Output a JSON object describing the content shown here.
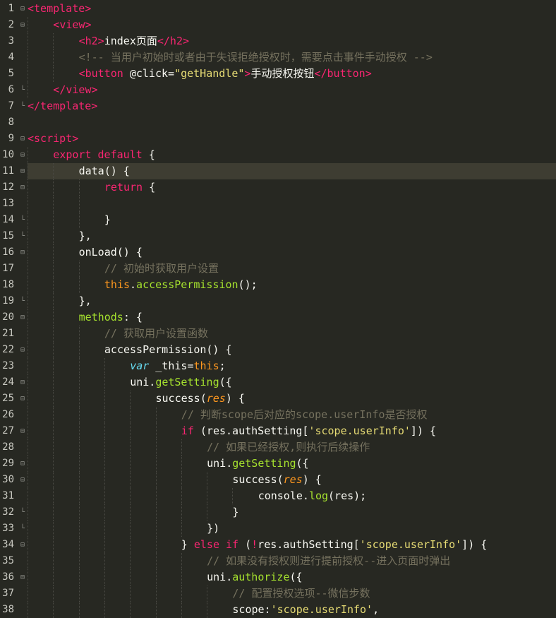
{
  "editor": {
    "theme_colors": {
      "background": "#272822",
      "active_line": "#3e3d32",
      "tag": "#f92672",
      "comment": "#75715e",
      "string": "#e6db74",
      "function": "#a6e22e",
      "this": "#fd971f",
      "text": "#f8f8f2"
    },
    "active_line": 11,
    "lines": [
      {
        "n": "1",
        "fold": "minus",
        "indent": 0,
        "tokens": [
          [
            "t-tag",
            "<template>"
          ]
        ]
      },
      {
        "n": "2",
        "fold": "minus",
        "indent": 1,
        "tokens": [
          [
            "t-tag",
            "<view>"
          ]
        ]
      },
      {
        "n": "3",
        "fold": "",
        "indent": 2,
        "tokens": [
          [
            "t-tag",
            "<h2>"
          ],
          [
            "t-txt",
            "index页面"
          ],
          [
            "t-tag",
            "</h2>"
          ]
        ]
      },
      {
        "n": "4",
        "fold": "",
        "indent": 2,
        "tokens": [
          [
            "t-cmt",
            "<!-- 当用户初始时或者由于失误拒绝授权时，需要点击事件手动授权 -->"
          ]
        ]
      },
      {
        "n": "5",
        "fold": "",
        "indent": 2,
        "tokens": [
          [
            "t-tag",
            "<button"
          ],
          [
            "t-attr",
            " @click="
          ],
          [
            "t-str",
            "\"getHandle\""
          ],
          [
            "t-tag",
            ">"
          ],
          [
            "t-txt",
            "手动授权按钮"
          ],
          [
            "t-tag",
            "</button>"
          ]
        ]
      },
      {
        "n": "6",
        "fold": "end",
        "indent": 1,
        "tokens": [
          [
            "t-tag",
            "</view>"
          ]
        ]
      },
      {
        "n": "7",
        "fold": "end",
        "indent": 0,
        "tokens": [
          [
            "t-tag",
            "</template>"
          ]
        ]
      },
      {
        "n": "8",
        "fold": "",
        "indent": 0,
        "tokens": []
      },
      {
        "n": "9",
        "fold": "minus",
        "indent": 0,
        "tokens": [
          [
            "t-tag",
            "<script>"
          ]
        ]
      },
      {
        "n": "10",
        "fold": "minus",
        "indent": 1,
        "tokens": [
          [
            "t-kw",
            "export default"
          ],
          [
            "t-txt",
            " {"
          ]
        ]
      },
      {
        "n": "11",
        "fold": "minus",
        "indent": 2,
        "tokens": [
          [
            "t-txt",
            "data() {"
          ]
        ]
      },
      {
        "n": "12",
        "fold": "minus",
        "indent": 3,
        "tokens": [
          [
            "t-kw",
            "return"
          ],
          [
            "t-txt",
            " {"
          ]
        ]
      },
      {
        "n": "13",
        "fold": "",
        "indent": 3,
        "tokens": []
      },
      {
        "n": "14",
        "fold": "end",
        "indent": 3,
        "tokens": [
          [
            "t-txt",
            "}"
          ]
        ]
      },
      {
        "n": "15",
        "fold": "end",
        "indent": 2,
        "tokens": [
          [
            "t-txt",
            "},"
          ]
        ]
      },
      {
        "n": "16",
        "fold": "minus",
        "indent": 2,
        "tokens": [
          [
            "t-txt",
            "onLoad() {"
          ]
        ]
      },
      {
        "n": "17",
        "fold": "",
        "indent": 3,
        "tokens": [
          [
            "t-cmt",
            "// 初始时获取用户设置"
          ]
        ]
      },
      {
        "n": "18",
        "fold": "",
        "indent": 3,
        "tokens": [
          [
            "t-this",
            "this"
          ],
          [
            "t-dot",
            "."
          ],
          [
            "t-prop",
            "accessPermission"
          ],
          [
            "t-txt",
            "();"
          ]
        ]
      },
      {
        "n": "19",
        "fold": "end",
        "indent": 2,
        "tokens": [
          [
            "t-txt",
            "},"
          ]
        ]
      },
      {
        "n": "20",
        "fold": "minus",
        "indent": 2,
        "tokens": [
          [
            "t-fn",
            "methods"
          ],
          [
            "t-txt",
            ": {"
          ]
        ]
      },
      {
        "n": "21",
        "fold": "",
        "indent": 3,
        "tokens": [
          [
            "t-cmt",
            "// 获取用户设置函数"
          ]
        ]
      },
      {
        "n": "22",
        "fold": "minus",
        "indent": 3,
        "tokens": [
          [
            "t-txt",
            "accessPermission() {"
          ]
        ]
      },
      {
        "n": "23",
        "fold": "",
        "indent": 4,
        "tokens": [
          [
            "t-var",
            "var"
          ],
          [
            "t-txt",
            " _this="
          ],
          [
            "t-this",
            "this"
          ],
          [
            "t-txt",
            ";"
          ]
        ]
      },
      {
        "n": "24",
        "fold": "minus",
        "indent": 4,
        "tokens": [
          [
            "t-txt",
            "uni"
          ],
          [
            "t-dot",
            "."
          ],
          [
            "t-prop",
            "getSetting"
          ],
          [
            "t-txt",
            "({"
          ]
        ]
      },
      {
        "n": "25",
        "fold": "minus",
        "indent": 5,
        "tokens": [
          [
            "t-txt",
            "success("
          ],
          [
            "t-par",
            "res"
          ],
          [
            "t-txt",
            ") {"
          ]
        ]
      },
      {
        "n": "26",
        "fold": "",
        "indent": 6,
        "tokens": [
          [
            "t-cmt",
            "// 判断scope后对应的scope.userInfo是否授权"
          ]
        ]
      },
      {
        "n": "27",
        "fold": "minus",
        "indent": 6,
        "tokens": [
          [
            "t-kw",
            "if"
          ],
          [
            "t-txt",
            " (res"
          ],
          [
            "t-dot",
            "."
          ],
          [
            "t-txt",
            "authSetting["
          ],
          [
            "t-str",
            "'scope.userInfo'"
          ],
          [
            "t-txt",
            "]) {"
          ]
        ]
      },
      {
        "n": "28",
        "fold": "",
        "indent": 7,
        "tokens": [
          [
            "t-cmt",
            "// 如果已经授权,则执行后续操作"
          ]
        ]
      },
      {
        "n": "29",
        "fold": "minus",
        "indent": 7,
        "tokens": [
          [
            "t-txt",
            "uni"
          ],
          [
            "t-dot",
            "."
          ],
          [
            "t-prop",
            "getSetting"
          ],
          [
            "t-txt",
            "({"
          ]
        ]
      },
      {
        "n": "30",
        "fold": "minus",
        "indent": 8,
        "tokens": [
          [
            "t-txt",
            "success("
          ],
          [
            "t-par",
            "res"
          ],
          [
            "t-txt",
            ") {"
          ]
        ]
      },
      {
        "n": "31",
        "fold": "",
        "indent": 9,
        "tokens": [
          [
            "t-txt",
            "console"
          ],
          [
            "t-dot",
            "."
          ],
          [
            "t-prop",
            "log"
          ],
          [
            "t-txt",
            "(res);"
          ]
        ]
      },
      {
        "n": "32",
        "fold": "end",
        "indent": 8,
        "tokens": [
          [
            "t-txt",
            "}"
          ]
        ]
      },
      {
        "n": "33",
        "fold": "end",
        "indent": 7,
        "tokens": [
          [
            "t-txt",
            "})"
          ]
        ]
      },
      {
        "n": "34",
        "fold": "minus",
        "indent": 6,
        "tokens": [
          [
            "t-txt",
            "} "
          ],
          [
            "t-kw",
            "else if"
          ],
          [
            "t-txt",
            " ("
          ],
          [
            "t-op",
            "!"
          ],
          [
            "t-txt",
            "res"
          ],
          [
            "t-dot",
            "."
          ],
          [
            "t-txt",
            "authSetting["
          ],
          [
            "t-str",
            "'scope.userInfo'"
          ],
          [
            "t-txt",
            "]) {"
          ]
        ]
      },
      {
        "n": "35",
        "fold": "",
        "indent": 7,
        "tokens": [
          [
            "t-cmt",
            "// 如果没有授权则进行提前授权--进入页面时弹出"
          ]
        ]
      },
      {
        "n": "36",
        "fold": "minus",
        "indent": 7,
        "tokens": [
          [
            "t-txt",
            "uni"
          ],
          [
            "t-dot",
            "."
          ],
          [
            "t-prop",
            "authorize"
          ],
          [
            "t-txt",
            "({"
          ]
        ]
      },
      {
        "n": "37",
        "fold": "",
        "indent": 8,
        "tokens": [
          [
            "t-cmt",
            "// 配置授权选项--微信步数"
          ]
        ]
      },
      {
        "n": "38",
        "fold": "",
        "indent": 8,
        "tokens": [
          [
            "t-txt",
            "scope:"
          ],
          [
            "t-str",
            "'scope.userInfo'"
          ],
          [
            "t-txt",
            ","
          ]
        ]
      }
    ]
  }
}
